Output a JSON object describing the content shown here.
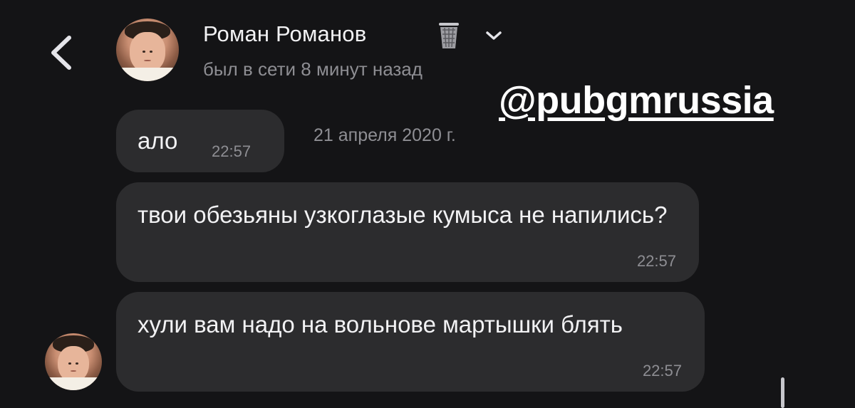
{
  "header": {
    "contact_name": "Роман Романов",
    "status": "был в сети 8 минут назад",
    "icons": {
      "back": "chevron-left-icon",
      "badge": "trash-can-icon",
      "expand": "chevron-down-icon"
    }
  },
  "watermark": "@pubgmrussia",
  "date_separator": "21 апреля 2020 г.",
  "messages": [
    {
      "text": "ало",
      "time": "22:57"
    },
    {
      "text": "твои обезьяны узкоглазые кумыса не напились?",
      "time": "22:57"
    },
    {
      "text": "хули вам надо на вольнове мартышки блять",
      "time": "22:57"
    }
  ],
  "colors": {
    "background": "#141416",
    "bubble": "#2c2c2e",
    "secondary_text": "#8e8e93",
    "primary_text": "#f2f2f4"
  }
}
